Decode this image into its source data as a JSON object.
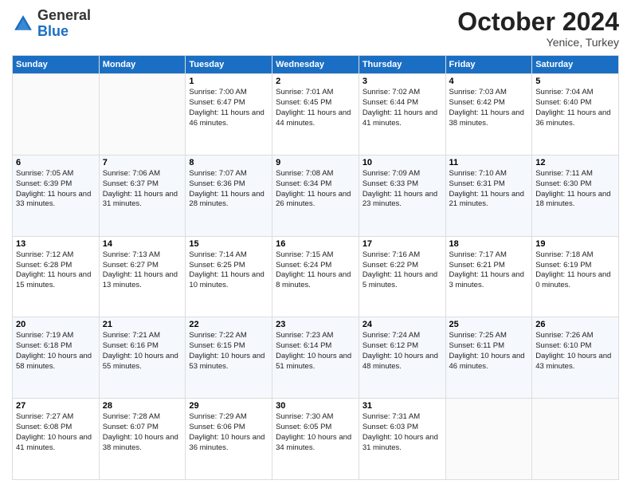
{
  "logo": {
    "general": "General",
    "blue": "Blue"
  },
  "header": {
    "month": "October 2024",
    "location": "Yenice, Turkey"
  },
  "days_of_week": [
    "Sunday",
    "Monday",
    "Tuesday",
    "Wednesday",
    "Thursday",
    "Friday",
    "Saturday"
  ],
  "weeks": [
    [
      {
        "day": "",
        "sunrise": "",
        "sunset": "",
        "daylight": ""
      },
      {
        "day": "",
        "sunrise": "",
        "sunset": "",
        "daylight": ""
      },
      {
        "day": "1",
        "sunrise": "Sunrise: 7:00 AM",
        "sunset": "Sunset: 6:47 PM",
        "daylight": "Daylight: 11 hours and 46 minutes."
      },
      {
        "day": "2",
        "sunrise": "Sunrise: 7:01 AM",
        "sunset": "Sunset: 6:45 PM",
        "daylight": "Daylight: 11 hours and 44 minutes."
      },
      {
        "day": "3",
        "sunrise": "Sunrise: 7:02 AM",
        "sunset": "Sunset: 6:44 PM",
        "daylight": "Daylight: 11 hours and 41 minutes."
      },
      {
        "day": "4",
        "sunrise": "Sunrise: 7:03 AM",
        "sunset": "Sunset: 6:42 PM",
        "daylight": "Daylight: 11 hours and 38 minutes."
      },
      {
        "day": "5",
        "sunrise": "Sunrise: 7:04 AM",
        "sunset": "Sunset: 6:40 PM",
        "daylight": "Daylight: 11 hours and 36 minutes."
      }
    ],
    [
      {
        "day": "6",
        "sunrise": "Sunrise: 7:05 AM",
        "sunset": "Sunset: 6:39 PM",
        "daylight": "Daylight: 11 hours and 33 minutes."
      },
      {
        "day": "7",
        "sunrise": "Sunrise: 7:06 AM",
        "sunset": "Sunset: 6:37 PM",
        "daylight": "Daylight: 11 hours and 31 minutes."
      },
      {
        "day": "8",
        "sunrise": "Sunrise: 7:07 AM",
        "sunset": "Sunset: 6:36 PM",
        "daylight": "Daylight: 11 hours and 28 minutes."
      },
      {
        "day": "9",
        "sunrise": "Sunrise: 7:08 AM",
        "sunset": "Sunset: 6:34 PM",
        "daylight": "Daylight: 11 hours and 26 minutes."
      },
      {
        "day": "10",
        "sunrise": "Sunrise: 7:09 AM",
        "sunset": "Sunset: 6:33 PM",
        "daylight": "Daylight: 11 hours and 23 minutes."
      },
      {
        "day": "11",
        "sunrise": "Sunrise: 7:10 AM",
        "sunset": "Sunset: 6:31 PM",
        "daylight": "Daylight: 11 hours and 21 minutes."
      },
      {
        "day": "12",
        "sunrise": "Sunrise: 7:11 AM",
        "sunset": "Sunset: 6:30 PM",
        "daylight": "Daylight: 11 hours and 18 minutes."
      }
    ],
    [
      {
        "day": "13",
        "sunrise": "Sunrise: 7:12 AM",
        "sunset": "Sunset: 6:28 PM",
        "daylight": "Daylight: 11 hours and 15 minutes."
      },
      {
        "day": "14",
        "sunrise": "Sunrise: 7:13 AM",
        "sunset": "Sunset: 6:27 PM",
        "daylight": "Daylight: 11 hours and 13 minutes."
      },
      {
        "day": "15",
        "sunrise": "Sunrise: 7:14 AM",
        "sunset": "Sunset: 6:25 PM",
        "daylight": "Daylight: 11 hours and 10 minutes."
      },
      {
        "day": "16",
        "sunrise": "Sunrise: 7:15 AM",
        "sunset": "Sunset: 6:24 PM",
        "daylight": "Daylight: 11 hours and 8 minutes."
      },
      {
        "day": "17",
        "sunrise": "Sunrise: 7:16 AM",
        "sunset": "Sunset: 6:22 PM",
        "daylight": "Daylight: 11 hours and 5 minutes."
      },
      {
        "day": "18",
        "sunrise": "Sunrise: 7:17 AM",
        "sunset": "Sunset: 6:21 PM",
        "daylight": "Daylight: 11 hours and 3 minutes."
      },
      {
        "day": "19",
        "sunrise": "Sunrise: 7:18 AM",
        "sunset": "Sunset: 6:19 PM",
        "daylight": "Daylight: 11 hours and 0 minutes."
      }
    ],
    [
      {
        "day": "20",
        "sunrise": "Sunrise: 7:19 AM",
        "sunset": "Sunset: 6:18 PM",
        "daylight": "Daylight: 10 hours and 58 minutes."
      },
      {
        "day": "21",
        "sunrise": "Sunrise: 7:21 AM",
        "sunset": "Sunset: 6:16 PM",
        "daylight": "Daylight: 10 hours and 55 minutes."
      },
      {
        "day": "22",
        "sunrise": "Sunrise: 7:22 AM",
        "sunset": "Sunset: 6:15 PM",
        "daylight": "Daylight: 10 hours and 53 minutes."
      },
      {
        "day": "23",
        "sunrise": "Sunrise: 7:23 AM",
        "sunset": "Sunset: 6:14 PM",
        "daylight": "Daylight: 10 hours and 51 minutes."
      },
      {
        "day": "24",
        "sunrise": "Sunrise: 7:24 AM",
        "sunset": "Sunset: 6:12 PM",
        "daylight": "Daylight: 10 hours and 48 minutes."
      },
      {
        "day": "25",
        "sunrise": "Sunrise: 7:25 AM",
        "sunset": "Sunset: 6:11 PM",
        "daylight": "Daylight: 10 hours and 46 minutes."
      },
      {
        "day": "26",
        "sunrise": "Sunrise: 7:26 AM",
        "sunset": "Sunset: 6:10 PM",
        "daylight": "Daylight: 10 hours and 43 minutes."
      }
    ],
    [
      {
        "day": "27",
        "sunrise": "Sunrise: 7:27 AM",
        "sunset": "Sunset: 6:08 PM",
        "daylight": "Daylight: 10 hours and 41 minutes."
      },
      {
        "day": "28",
        "sunrise": "Sunrise: 7:28 AM",
        "sunset": "Sunset: 6:07 PM",
        "daylight": "Daylight: 10 hours and 38 minutes."
      },
      {
        "day": "29",
        "sunrise": "Sunrise: 7:29 AM",
        "sunset": "Sunset: 6:06 PM",
        "daylight": "Daylight: 10 hours and 36 minutes."
      },
      {
        "day": "30",
        "sunrise": "Sunrise: 7:30 AM",
        "sunset": "Sunset: 6:05 PM",
        "daylight": "Daylight: 10 hours and 34 minutes."
      },
      {
        "day": "31",
        "sunrise": "Sunrise: 7:31 AM",
        "sunset": "Sunset: 6:03 PM",
        "daylight": "Daylight: 10 hours and 31 minutes."
      },
      {
        "day": "",
        "sunrise": "",
        "sunset": "",
        "daylight": ""
      },
      {
        "day": "",
        "sunrise": "",
        "sunset": "",
        "daylight": ""
      }
    ]
  ]
}
